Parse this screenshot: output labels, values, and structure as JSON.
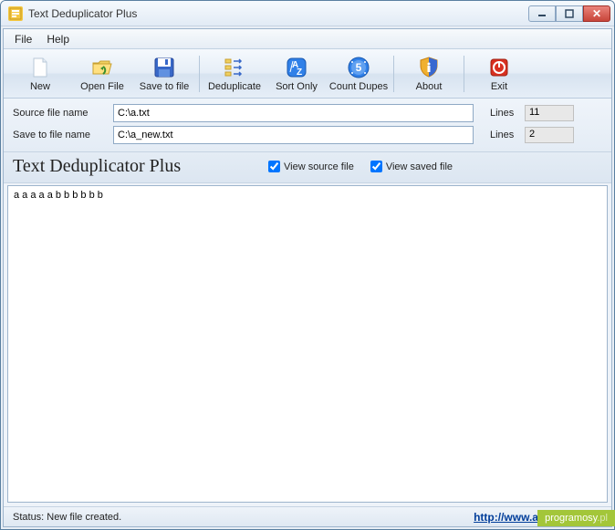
{
  "window": {
    "title": "Text Deduplicator Plus"
  },
  "menu": {
    "file": "File",
    "help": "Help"
  },
  "toolbar": {
    "new": "New",
    "open": "Open File",
    "save": "Save to file",
    "dedupe": "Deduplicate",
    "sort": "Sort Only",
    "count": "Count Dupes",
    "about": "About",
    "exit": "Exit"
  },
  "fields": {
    "source_label": "Source file name",
    "source_value": "C:\\a.txt",
    "save_label": "Save to file name",
    "save_value": "C:\\a_new.txt",
    "lines_label": "Lines",
    "lines_source": "11",
    "lines_saved": "2"
  },
  "heading": "Text Deduplicator Plus",
  "checks": {
    "view_source": "View source file",
    "view_saved": "View saved file"
  },
  "content_lines": [
    "a",
    "a",
    "a",
    "a",
    "a",
    "b",
    "b",
    "b",
    "b",
    "b",
    "b"
  ],
  "status": {
    "text": "Status: New file created.",
    "link": "http://www.alexnolan.net"
  },
  "watermark": {
    "main": "programosy",
    "suffix": ".pl"
  }
}
